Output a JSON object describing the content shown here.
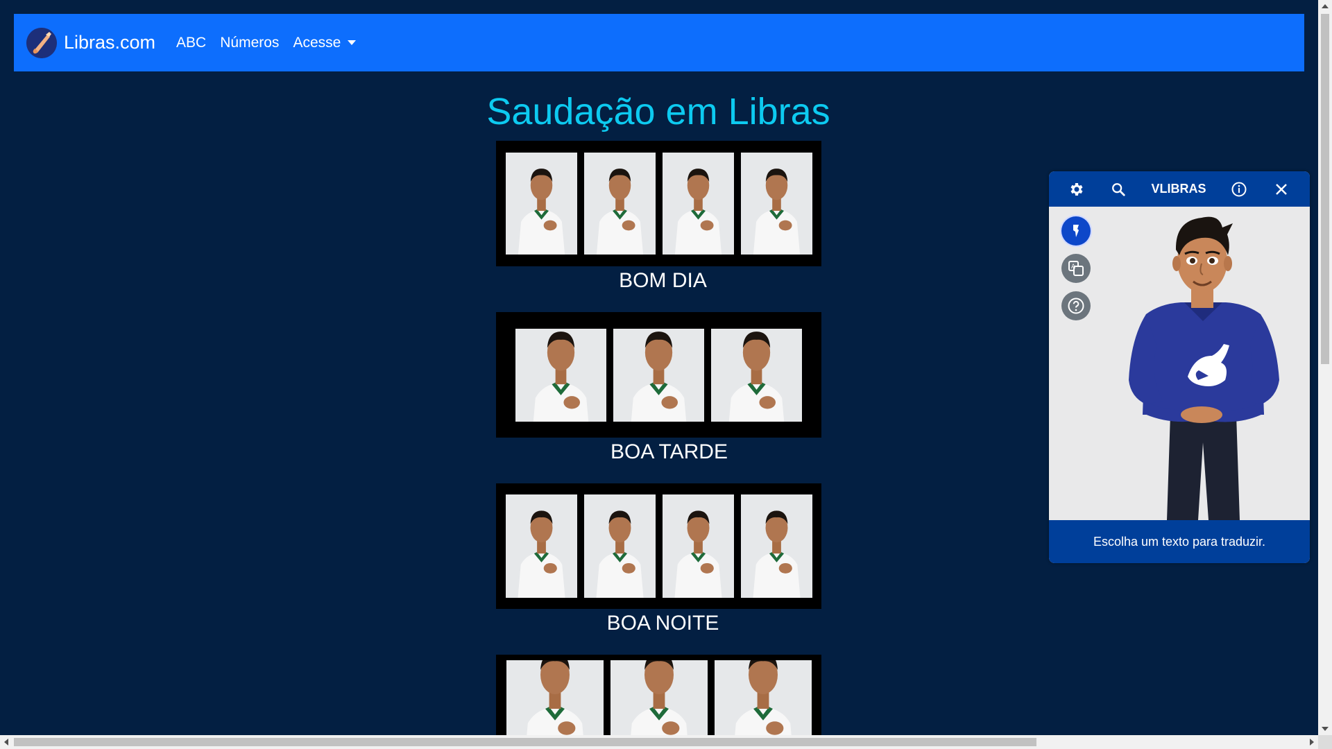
{
  "navbar": {
    "brand": "Libras.com",
    "links": [
      "ABC",
      "Números"
    ],
    "dropdown": "Acesse",
    "bg_color": "#0d6efd"
  },
  "main": {
    "title": "Saudação em Libras",
    "title_color": "#0dcaf0",
    "cards": [
      {
        "caption": "BOM DIA",
        "photo_count": 4
      },
      {
        "caption": "BOA TARDE",
        "photo_count": 3
      },
      {
        "caption": "BOA NOITE",
        "photo_count": 4
      },
      {
        "caption": "",
        "photo_count": 3
      }
    ]
  },
  "vlibras": {
    "title": "VLIBRAS",
    "header_icons": [
      "gear-icon",
      "search-icon",
      "info-icon",
      "close-icon"
    ],
    "side_buttons": [
      "avatar-icon",
      "translate-icon",
      "help-icon"
    ],
    "footer_text": "Escolha um texto para traduzir."
  }
}
